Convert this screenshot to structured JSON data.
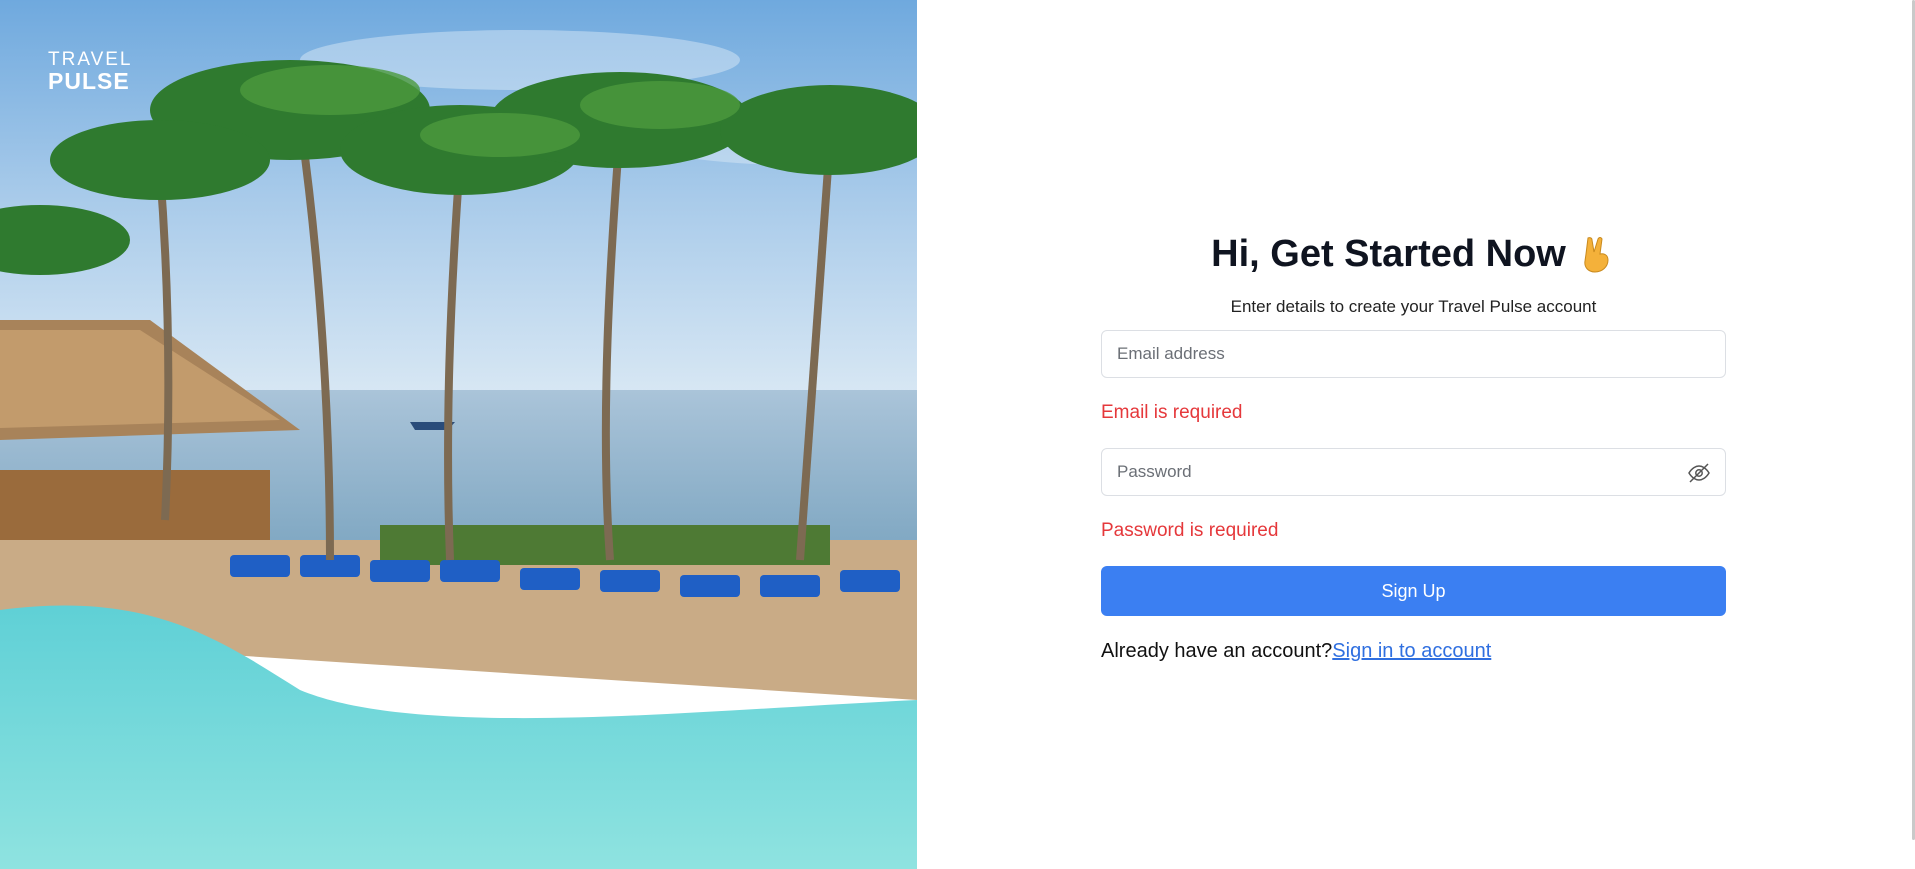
{
  "brand": {
    "logo_line1": "TRAVEL",
    "logo_line2": "PULSE"
  },
  "form": {
    "title": "Hi, Get Started Now",
    "emoji": "peace-hand",
    "subtitle": "Enter details to create your Travel Pulse account",
    "email_placeholder": "Email address",
    "email_error": "Email is required",
    "password_placeholder": "Password",
    "password_error": "Password is required",
    "submit_label": "Sign Up",
    "account_prompt": "Already have an account?",
    "signin_link": "Sign in to account"
  },
  "colors": {
    "primary": "#3b7ff2",
    "error": "#e5383b",
    "link": "#2f6fe0",
    "title": "#0f1420"
  },
  "icons": {
    "password_toggle": "eye-off-icon"
  }
}
